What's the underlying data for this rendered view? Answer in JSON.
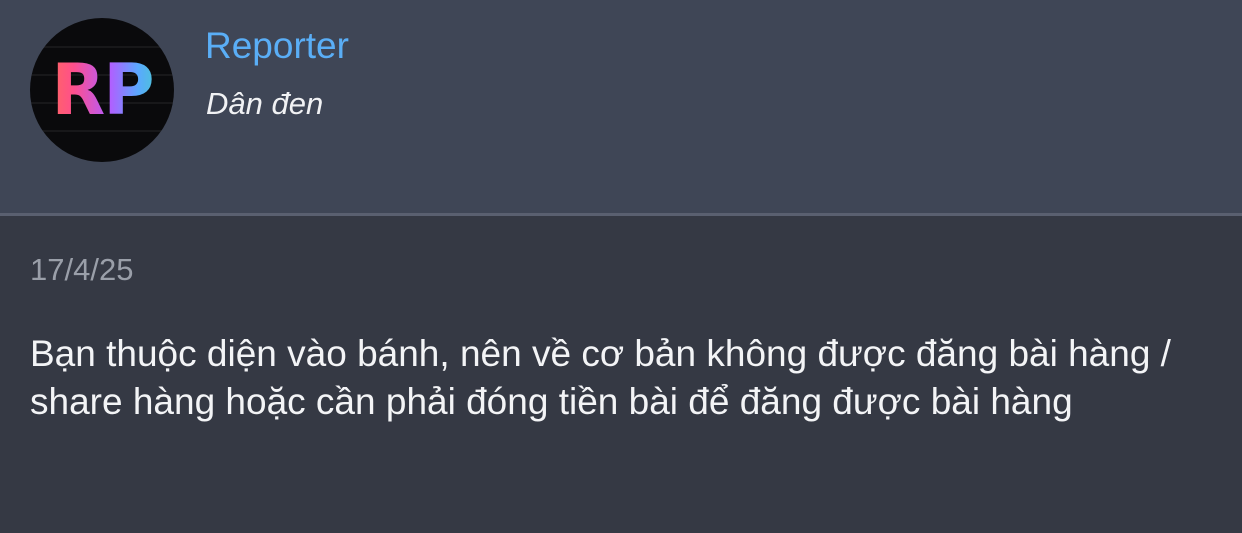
{
  "profile": {
    "avatar_text": "RP",
    "name": "Reporter",
    "subtitle": "Dân đen"
  },
  "post": {
    "date": "17/4/25",
    "text": "Bạn thuộc diện vào bánh, nên về cơ bản không được đăng bài hàng / share hàng hoặc cần phải đóng tiền bài để đăng được bài hàng"
  },
  "colors": {
    "header_bg": "#3f4656",
    "body_bg": "#353944",
    "name_color": "#5aaef6"
  }
}
